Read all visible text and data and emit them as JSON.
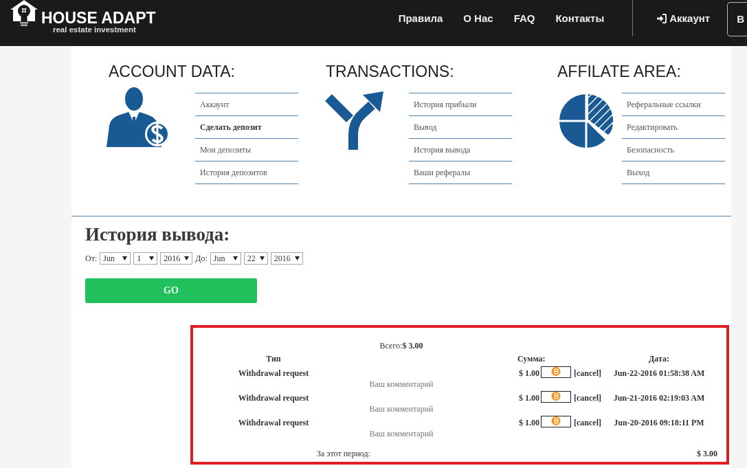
{
  "header": {
    "brand": "HOUSE ADAPT",
    "tagline": "real estate investment",
    "nav": [
      "Правила",
      "О Нас",
      "FAQ",
      "Контакты"
    ],
    "account_link": "Аккаунт",
    "cut_button": "В"
  },
  "sections": [
    {
      "title": "ACCOUNT DATA:",
      "kind": "person",
      "items": [
        {
          "label": "Аккаунт",
          "selected": false
        },
        {
          "label": "Сделать депозит",
          "selected": true
        },
        {
          "label": "Мои депозиты",
          "selected": false
        },
        {
          "label": "История депозитов",
          "selected": false
        }
      ]
    },
    {
      "title": "TRANSACTIONS:",
      "kind": "fork",
      "items": [
        {
          "label": "История прибыли",
          "selected": false
        },
        {
          "label": "Вывод",
          "selected": false
        },
        {
          "label": "История вывода",
          "selected": false
        },
        {
          "label": "Ваши рефералы",
          "selected": false
        }
      ]
    },
    {
      "title": "AFFILATE AREA:",
      "kind": "pie",
      "items": [
        {
          "label": "Реферальные ссылки",
          "selected": false
        },
        {
          "label": "Редактировать",
          "selected": false
        },
        {
          "label": "Безопасность",
          "selected": false
        },
        {
          "label": "Выход",
          "selected": false
        }
      ]
    }
  ],
  "history": {
    "title": "История вывода:",
    "from_label": "От:",
    "from": {
      "month": "Jun",
      "day": "1",
      "year": "2016"
    },
    "to_label": "До:",
    "to": {
      "month": "Jun",
      "day": "22",
      "year": "2016"
    },
    "button": "GO"
  },
  "report": {
    "total": "Всего:**$ 3.00**",
    "columns": [
      "Тип",
      "Сумма:",
      "Дата:"
    ],
    "rows": [
      {
        "type": "Withdrawal request",
        "amount": "$ 1.00",
        "action": "[cancel]",
        "date": "Jun-22-2016 01:58:38 AM",
        "comment": "Ваш комментарий"
      },
      {
        "type": "Withdrawal request",
        "amount": "$ 1.00",
        "action": "[cancel]",
        "date": "Jun-21-2016 02:19:03 AM",
        "comment": "Ваш комментарий"
      },
      {
        "type": "Withdrawal request",
        "amount": "$ 1.00",
        "action": "[cancel]",
        "date": "Jun-20-2016 09:18:11 PM",
        "comment": "Ваш комментарий"
      }
    ],
    "period_label": "За этот период:",
    "period_total": "$ 3.00"
  }
}
